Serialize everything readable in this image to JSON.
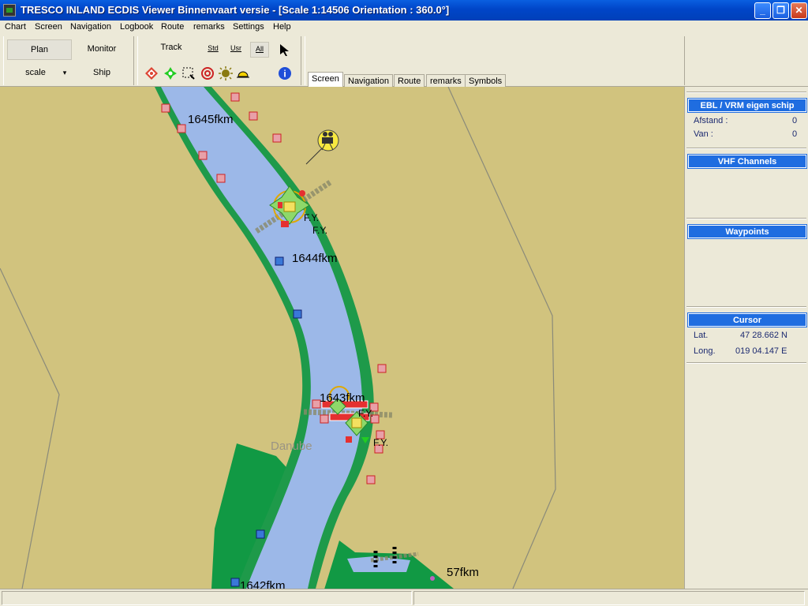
{
  "window": {
    "title": "TRESCO INLAND ECDIS Viewer Binnenvaart versie - [Scale 1:14506 Orientation :  360.0°]",
    "minimize": "_",
    "maximize": "❐",
    "close": "✕"
  },
  "menu": [
    "Chart",
    "Screen",
    "Navigation",
    "Logbook",
    "Route",
    "remarks",
    "Settings",
    "Help"
  ],
  "toolbar": {
    "plan": "Plan",
    "monitor": "Monitor",
    "scale": "scale",
    "scale_arrow": "▾",
    "ship": "Ship",
    "track": "Track",
    "std": "Std",
    "usr": "Usr",
    "all": "All"
  },
  "tabs": [
    "Screen",
    "Navigation",
    "Route",
    "remarks",
    "Symbols"
  ],
  "map": {
    "km_1645": "1645fkm",
    "km_1644": "1644fkm",
    "km_1643": "1643fkm",
    "km_1642": "1642fkm",
    "km_57": "57fkm",
    "river_name": "Danube",
    "fy1": "F.Y.",
    "fy2": "F.Y.",
    "fy3": "F.Y.",
    "fy4": "F.Y."
  },
  "panels": {
    "ebl": {
      "title": "EBL / VRM eigen schip",
      "afstand_label": "Afstand :",
      "afstand_value": "0",
      "van_label": "Van :",
      "van_value": "0"
    },
    "vhf": {
      "title": "VHF Channels"
    },
    "waypoints": {
      "title": "Waypoints"
    },
    "cursor": {
      "title": "Cursor",
      "lat_label": "Lat.",
      "lat_value": "47 28.662 N",
      "long_label": "Long.",
      "long_value": "019 04.147 E"
    }
  },
  "colors": {
    "land": "#D1C37E",
    "water": "#9CB8E8",
    "bank": "#1E9A4A",
    "panel_header": "#1F6DE0"
  }
}
